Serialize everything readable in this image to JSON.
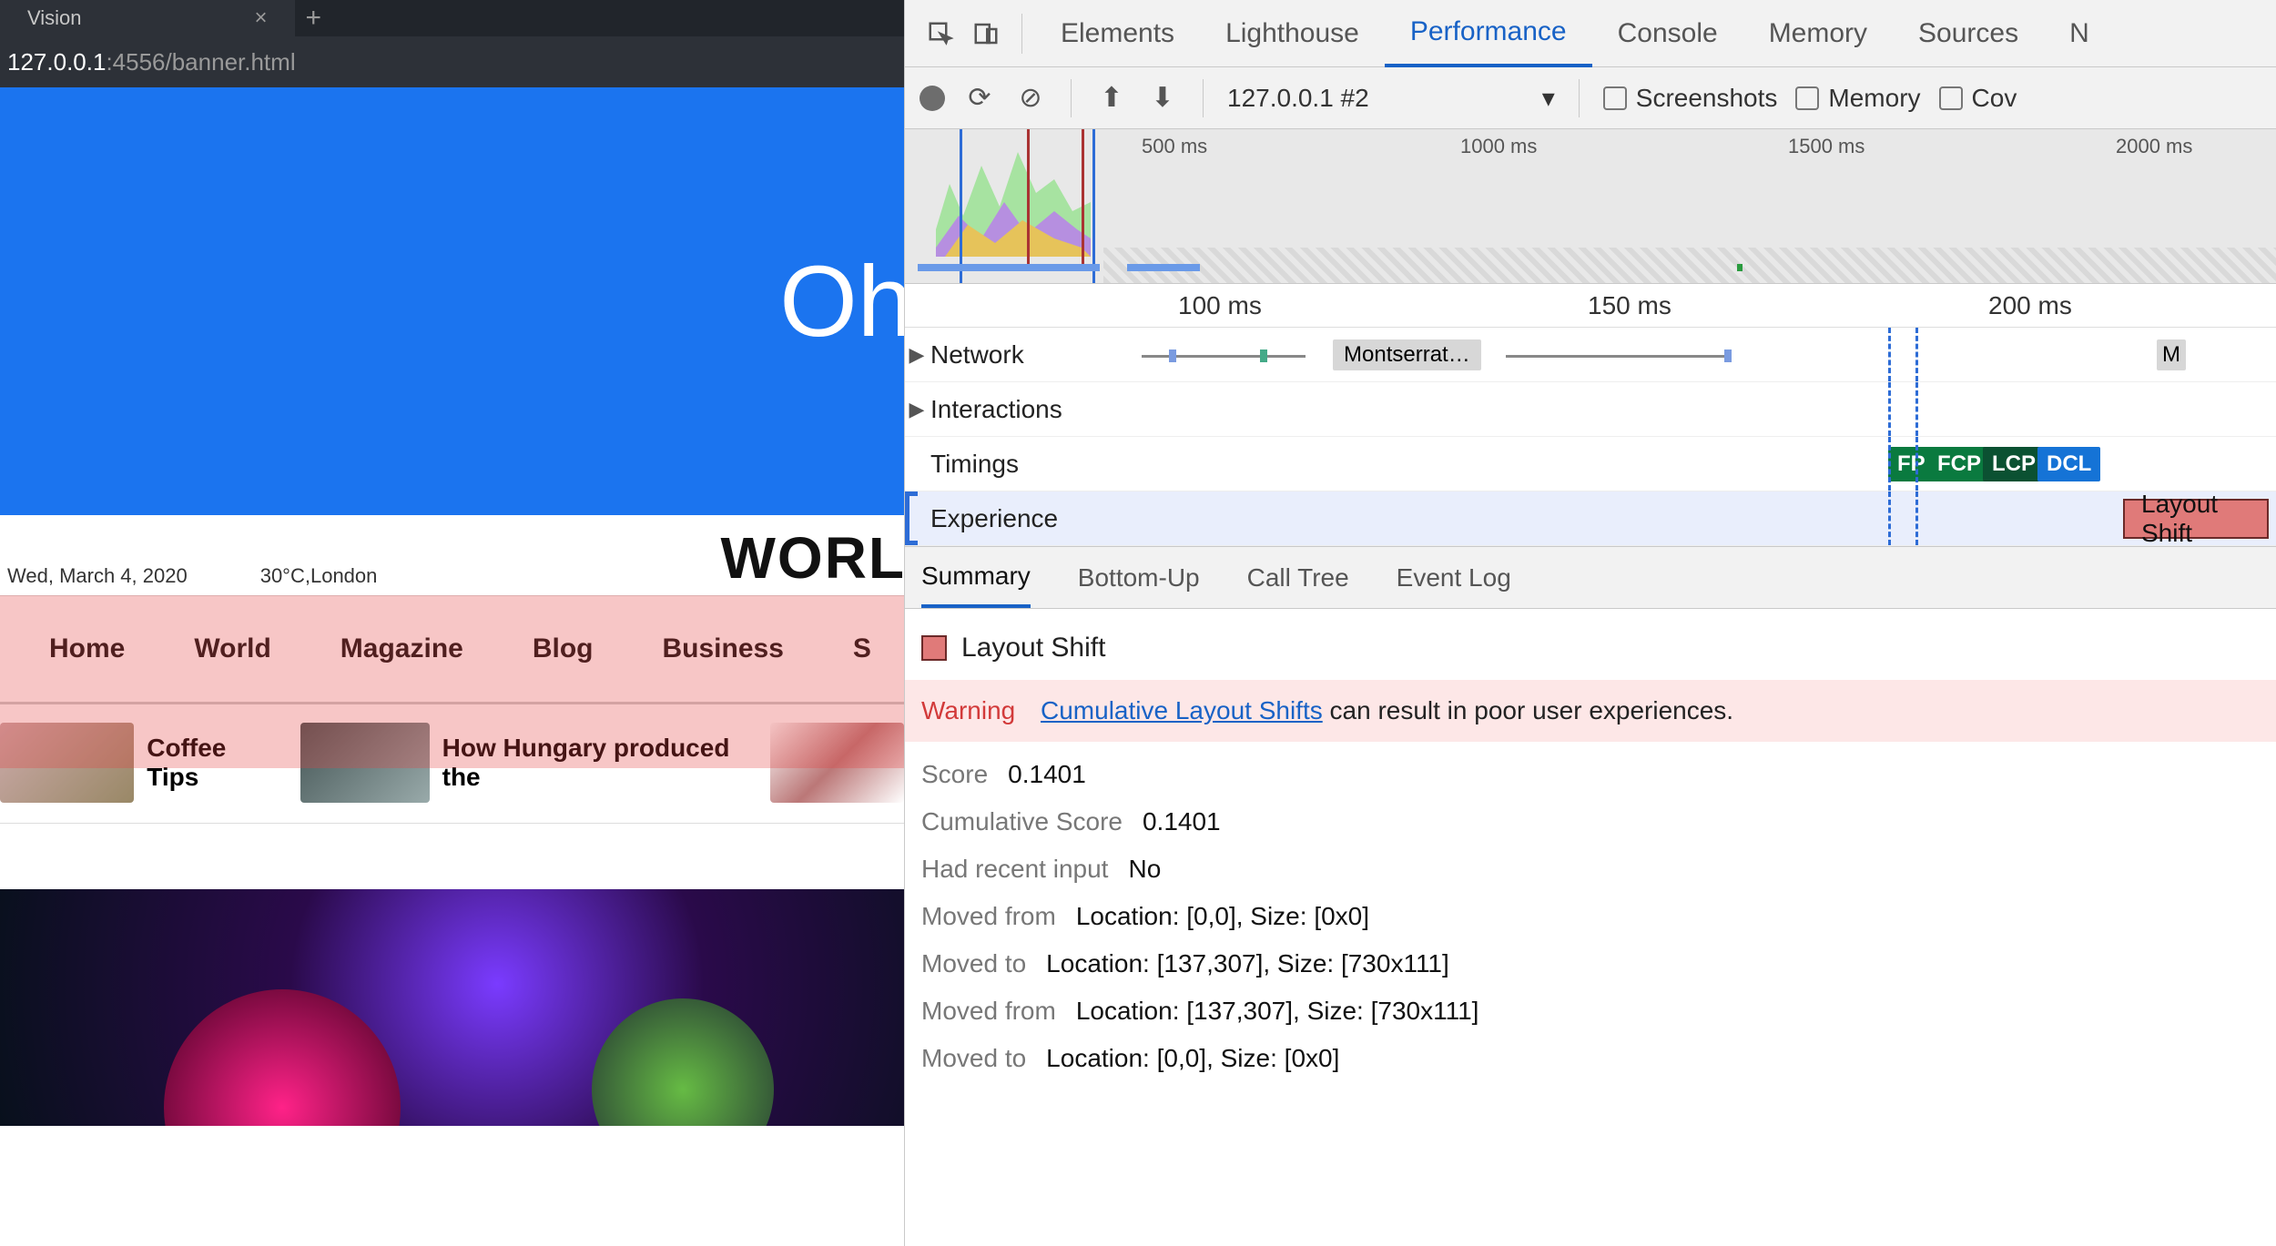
{
  "browser": {
    "tab_title": "Vision",
    "address_host": "127.0.0.1",
    "address_port_path": ":4556/banner.html",
    "banner_text": "Oh",
    "date": "Wed, March 4, 2020",
    "weather": "30°C,London",
    "site_title": "WORL",
    "nav": [
      "Home",
      "World",
      "Magazine",
      "Blog",
      "Business",
      "S"
    ],
    "stories": [
      {
        "title": "Coffee Tips"
      },
      {
        "title": "How Hungary produced the"
      }
    ]
  },
  "devtools": {
    "tabs": [
      "Elements",
      "Lighthouse",
      "Performance",
      "Console",
      "Memory",
      "Sources",
      "N"
    ],
    "active_tab": "Performance",
    "toolbar": {
      "recording_dropdown": "127.0.0.1 #2",
      "checks": [
        "Screenshots",
        "Memory",
        "Cov"
      ]
    },
    "overview_ticks": [
      "500 ms",
      "1000 ms",
      "1500 ms",
      "2000 ms"
    ],
    "ruler_ticks": [
      "100 ms",
      "150 ms",
      "200 ms"
    ],
    "lanes": {
      "network": "Network",
      "network_item": "Montserrat…",
      "network_item2": "M",
      "interactions": "Interactions",
      "timings": "Timings",
      "timing_markers": [
        "FP",
        "FCP",
        "LCP",
        "DCL"
      ],
      "experience": "Experience",
      "experience_event": "Layout Shift"
    },
    "subtabs": [
      "Summary",
      "Bottom-Up",
      "Call Tree",
      "Event Log"
    ],
    "active_subtab": "Summary",
    "details": {
      "title": "Layout Shift",
      "warning_label": "Warning",
      "warning_link": "Cumulative Layout Shifts",
      "warning_tail": " can result in poor user experiences.",
      "rows": [
        {
          "k": "Score",
          "v": "0.1401"
        },
        {
          "k": "Cumulative Score",
          "v": "0.1401"
        },
        {
          "k": "Had recent input",
          "v": "No"
        },
        {
          "k": "Moved from",
          "v": "Location: [0,0], Size: [0x0]"
        },
        {
          "k": "Moved to",
          "v": "Location: [137,307], Size: [730x111]"
        },
        {
          "k": "Moved from",
          "v": "Location: [137,307], Size: [730x111]"
        },
        {
          "k": "Moved to",
          "v": "Location: [0,0], Size: [0x0]"
        }
      ]
    }
  }
}
